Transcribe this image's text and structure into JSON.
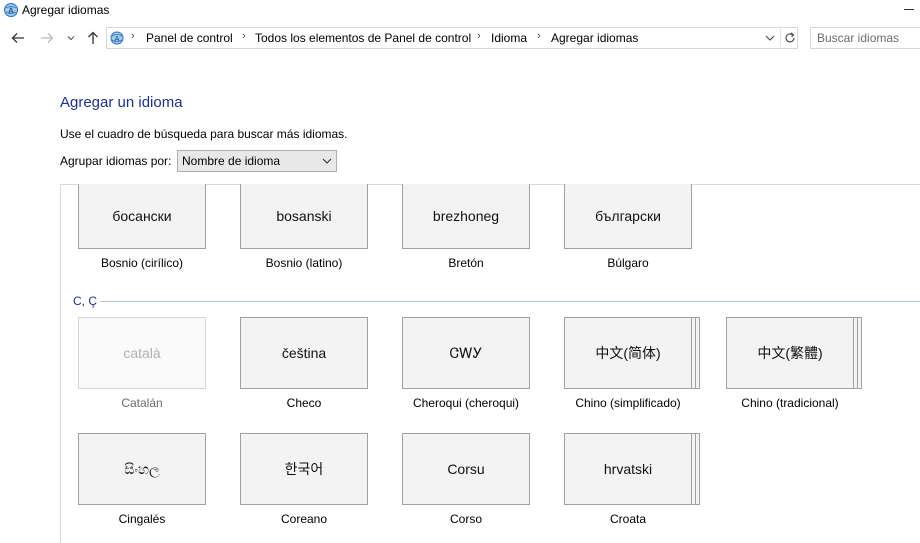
{
  "window": {
    "title": "Agregar idiomas"
  },
  "nav": {
    "back_icon": "arrow-left-icon",
    "forward_icon": "arrow-right-icon",
    "recent_icon": "chevron-down-icon",
    "up_icon": "arrow-up-icon",
    "breadcrumbs": [
      "Panel de control",
      "Todos los elementos de Panel de control",
      "Idioma",
      "Agregar idiomas"
    ],
    "refresh_icon": "refresh-icon"
  },
  "search": {
    "placeholder": "Buscar idiomas"
  },
  "page": {
    "heading": "Agregar un idioma",
    "instruction": "Use el cuadro de búsqueda para buscar más idiomas.",
    "group_by_label": "Agrupar idiomas por:",
    "group_by_value": "Nombre de idioma"
  },
  "languages_top": [
    {
      "native": "босански",
      "name": "Bosnio (cirílico)"
    },
    {
      "native": "bosanski",
      "name": "Bosnio (latino)"
    },
    {
      "native": "brezhoneg",
      "name": "Bretón"
    },
    {
      "native": "български",
      "name": "Búlgaro"
    }
  ],
  "section_c": {
    "label": "C, Ç",
    "languages": [
      {
        "native": "català",
        "name": "Catalán",
        "disabled": true
      },
      {
        "native": "čeština",
        "name": "Checo"
      },
      {
        "native": "ᏣᎳᎩ",
        "name": "Cheroqui (cheroqui)"
      },
      {
        "native": "中文(简体)",
        "name": "Chino (simplificado)",
        "stacked": true
      },
      {
        "native": "中文(繁體)",
        "name": "Chino (tradicional)",
        "stacked": true
      },
      {
        "native": "සිංහල",
        "name": "Cingalés"
      },
      {
        "native": "한국어",
        "name": "Coreano"
      },
      {
        "native": "Corsu",
        "name": "Corso"
      },
      {
        "native": "hrvatski",
        "name": "Croata",
        "stacked": true
      }
    ]
  },
  "colors": {
    "heading": "#1e3287",
    "tile_bg": "#f3f3f3",
    "tile_border": "#a0a0a0"
  }
}
